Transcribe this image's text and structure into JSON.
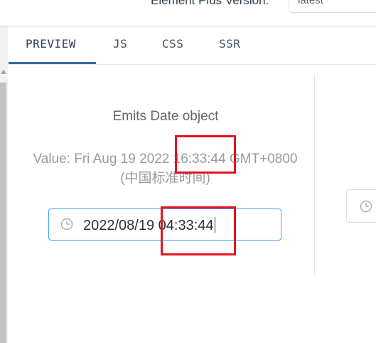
{
  "header": {
    "version_label": "Element Plus Version:",
    "version_value": "latest"
  },
  "tabs": [
    {
      "label": "PREVIEW",
      "active": true
    },
    {
      "label": "JS",
      "active": false
    },
    {
      "label": "CSS",
      "active": false
    },
    {
      "label": "SSR",
      "active": false
    }
  ],
  "preview": {
    "title": "Emits Date object",
    "value_line1": "Value: Fri Aug 19 2022 16:33:44 GMT+0800",
    "value_line2": "(中国标准时间)",
    "time_picker_value": "2022/08/19 04:33:44"
  },
  "icons": {
    "time_picker_icon": "clock-icon",
    "right_widget_icon": "clock-icon"
  },
  "colors": {
    "accent": "#409eff",
    "tab_indicator": "#3b6a9a",
    "highlight": "#e5131f"
  }
}
